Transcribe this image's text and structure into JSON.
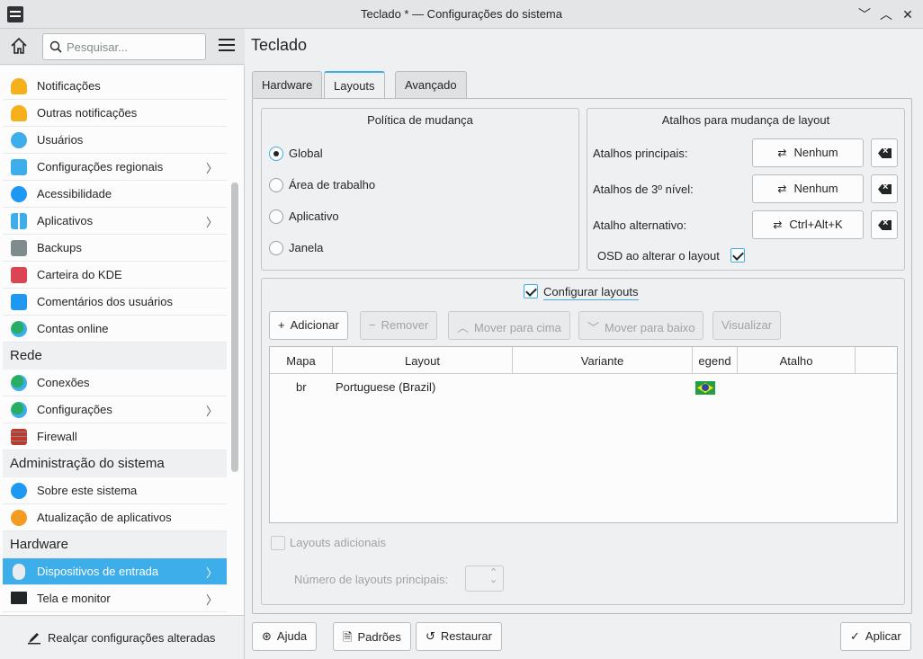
{
  "window": {
    "title": "Teclado * — Configurações do sistema",
    "minimize_icon": "chevron-down-icon",
    "maximize_icon": "chevron-up-icon",
    "close_icon": "close-icon"
  },
  "sidebar": {
    "search_placeholder": "Pesquisar...",
    "items": [
      {
        "label": "Notificações",
        "icon": "bell-icon",
        "color": "#f6b01b",
        "chevron": false
      },
      {
        "label": "Outras notificações",
        "icon": "bell-icon",
        "color": "#f6b01b",
        "chevron": false
      },
      {
        "label": "Usuários",
        "icon": "users-icon",
        "color": "#3daee9",
        "chevron": false
      },
      {
        "label": "Configurações regionais",
        "icon": "flag-chat-icon",
        "color": "#3daee9",
        "chevron": true
      },
      {
        "label": "Acessibilidade",
        "icon": "accessibility-icon",
        "color": "#1d99f3",
        "chevron": false
      },
      {
        "label": "Aplicativos",
        "icon": "apps-grid-icon",
        "color": "#3daee9",
        "chevron": true
      },
      {
        "label": "Backups",
        "icon": "backup-drive-icon",
        "color": "#7f8c8d",
        "chevron": false
      },
      {
        "label": "Carteira do KDE",
        "icon": "wallet-icon",
        "color": "#da4453",
        "chevron": false
      },
      {
        "label": "Comentários dos usuários",
        "icon": "feedback-icon",
        "color": "#1d99f3",
        "chevron": false
      },
      {
        "label": "Contas online",
        "icon": "globe-icon",
        "color": "#27ae60",
        "chevron": false
      }
    ],
    "section_network": "Rede",
    "network_items": [
      {
        "label": "Conexões",
        "icon": "globe-icon",
        "color": "#27ae60",
        "chevron": false
      },
      {
        "label": "Configurações",
        "icon": "globe-icon",
        "color": "#27ae60",
        "chevron": true
      },
      {
        "label": "Firewall",
        "icon": "firewall-icon",
        "color": "#c0392b",
        "chevron": false
      }
    ],
    "section_admin": "Administração do sistema",
    "admin_items": [
      {
        "label": "Sobre este sistema",
        "icon": "info-icon",
        "color": "#1d99f3",
        "chevron": false
      },
      {
        "label": "Atualização de aplicativos",
        "icon": "update-icon",
        "color": "#f39c1f",
        "chevron": false
      }
    ],
    "section_hardware": "Hardware",
    "hardware_items": [
      {
        "label": "Dispositivos de entrada",
        "icon": "mouse-icon",
        "color": "#ffffff",
        "chevron": true,
        "active": true
      },
      {
        "label": "Tela e monitor",
        "icon": "monitor-icon",
        "color": "#232627",
        "chevron": true
      }
    ],
    "highlight_button": "Realçar configurações alteradas"
  },
  "main": {
    "title": "Teclado",
    "tabs": [
      "Hardware",
      "Layouts",
      "Avançado"
    ],
    "active_tab": "Layouts",
    "switch_policy": {
      "title": "Política de mudança",
      "options": [
        "Global",
        "Área de trabalho",
        "Aplicativo",
        "Janela"
      ],
      "selected": "Global"
    },
    "shortcuts": {
      "title": "Atalhos para mudança de layout",
      "main_label": "Atalhos principais:",
      "main_value": "Nenhum",
      "third_label": "Atalhos de 3º nível:",
      "third_value": "Nenhum",
      "alt_label": "Atalho alternativo:",
      "alt_value": "Ctrl+Alt+K",
      "osd_label": "OSD ao alterar o layout",
      "osd_checked": true
    },
    "configure_layouts": {
      "label": "Configurar layouts",
      "checked": true,
      "add": "Adicionar",
      "remove": "Remover",
      "move_up": "Mover para cima",
      "move_down": "Mover para baixo",
      "preview": "Visualizar",
      "columns": [
        "Mapa",
        "Layout",
        "Variante",
        "egend",
        "Atalho"
      ],
      "rows": [
        {
          "map": "br",
          "layout": "Portuguese (Brazil)",
          "variant": "",
          "legend": "brazil-flag-icon",
          "shortcut": ""
        }
      ],
      "extra_layouts": "Layouts adicionais",
      "main_layouts_count": "Número de layouts principais:"
    },
    "footer": {
      "help": "Ajuda",
      "defaults": "Padrões",
      "reset": "Restaurar",
      "apply": "Aplicar"
    }
  },
  "colors": {
    "accent": "#3daee9",
    "window_bg": "#eff0f1",
    "view_bg": "#fcfcfc"
  }
}
